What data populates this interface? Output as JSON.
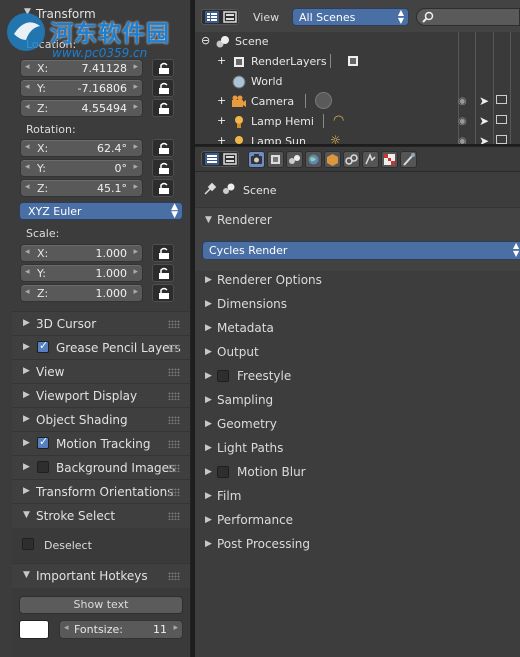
{
  "left": {
    "transform_header": "Transform",
    "location_label": "Location:",
    "location": [
      {
        "axis": "X:",
        "value": "7.41128"
      },
      {
        "axis": "Y:",
        "value": "-7.16806"
      },
      {
        "axis": "Z:",
        "value": "4.55494"
      }
    ],
    "rotation_label": "Rotation:",
    "rotation": [
      {
        "axis": "X:",
        "value": "62.4°"
      },
      {
        "axis": "Y:",
        "value": "0°"
      },
      {
        "axis": "Z:",
        "value": "45.1°"
      }
    ],
    "rotation_mode": "XYZ Euler",
    "scale_label": "Scale:",
    "scale": [
      {
        "axis": "X:",
        "value": "1.000"
      },
      {
        "axis": "Y:",
        "value": "1.000"
      },
      {
        "axis": "Z:",
        "value": "1.000"
      }
    ],
    "panels": [
      {
        "label": "3D Cursor",
        "checkbox": null
      },
      {
        "label": "Grease Pencil Layers",
        "checkbox": true
      },
      {
        "label": "View",
        "checkbox": null
      },
      {
        "label": "Viewport Display",
        "checkbox": null
      },
      {
        "label": "Object Shading",
        "checkbox": null
      },
      {
        "label": "Motion Tracking",
        "checkbox": true
      },
      {
        "label": "Background Images",
        "checkbox": false
      },
      {
        "label": "Transform Orientations",
        "checkbox": null
      },
      {
        "label": "Stroke Select",
        "checkbox": null
      }
    ],
    "deselect_label": "Deselect",
    "hotkeys_header": "Important Hotkeys",
    "show_text_label": "Show text",
    "fontsize_label": "Fontsize:",
    "fontsize_value": "11"
  },
  "outliner": {
    "view_label": "View",
    "scene_dropdown": "All Scenes",
    "items": [
      {
        "label": "Scene",
        "icon": "scene-icon"
      },
      {
        "label": "RenderLayers",
        "icon": "render-layers-icon"
      },
      {
        "label": "World",
        "icon": "world-icon"
      },
      {
        "label": "Camera",
        "icon": "camera-icon"
      },
      {
        "label": "Lamp Hemi",
        "icon": "lamp-icon"
      },
      {
        "label": "Lamp Sun",
        "icon": "lamp-icon"
      }
    ]
  },
  "properties": {
    "context_label": "Scene",
    "renderer_header": "Renderer",
    "render_engine": "Cycles Render",
    "sections": [
      {
        "label": "Renderer Options",
        "checkbox": null
      },
      {
        "label": "Dimensions",
        "checkbox": null
      },
      {
        "label": "Metadata",
        "checkbox": null
      },
      {
        "label": "Output",
        "checkbox": null
      },
      {
        "label": "Freestyle",
        "checkbox": false
      },
      {
        "label": "Sampling",
        "checkbox": null
      },
      {
        "label": "Geometry",
        "checkbox": null
      },
      {
        "label": "Light Paths",
        "checkbox": null
      },
      {
        "label": "Motion Blur",
        "checkbox": false
      },
      {
        "label": "Film",
        "checkbox": null
      },
      {
        "label": "Performance",
        "checkbox": null
      },
      {
        "label": "Post Processing",
        "checkbox": null
      }
    ]
  },
  "watermark": {
    "title": "河东软件园",
    "url": "www.pc0359.cn"
  },
  "colors": {
    "accent_blue": "#4a6fa5",
    "checkbox_blue": "#5680c2",
    "panel_bg": "#3c3c3c"
  }
}
